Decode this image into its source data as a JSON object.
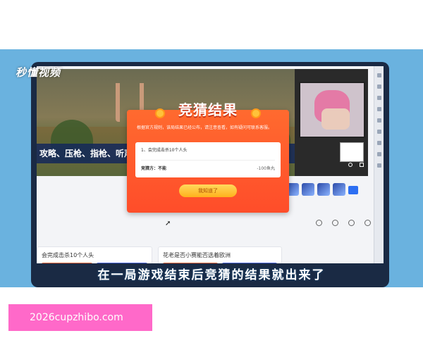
{
  "video": {
    "watermark": "秒懂视频",
    "caption": "在一局游戏结束后竞猜的结果就出来了"
  },
  "stream": {
    "banner_text": "攻略、压枪、指枪、听声辩"
  },
  "modal": {
    "title": "竞猜结果",
    "notice": "根据官方规则，该局结果已经公布，请注意查看，如有疑问可联系客服。",
    "question": "1、会完成击杀10个人头",
    "result_label": "竞猜方：不能",
    "amount": "-100鱼丸",
    "button_label": "我知道了"
  },
  "page": {
    "card1_title": "会完成击杀10个人头",
    "card2_title": "花老是否小赛能否选着欧洲"
  },
  "footer": {
    "url": "2026cupzhibo.com"
  },
  "colors": {
    "video_bg": "#6ab2df",
    "modal_accent": "#ff5a2d",
    "url_box": "#ff69c9"
  }
}
